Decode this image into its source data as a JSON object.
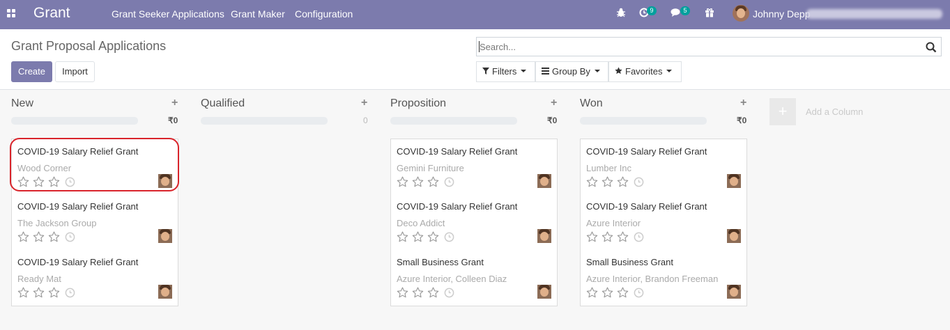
{
  "topbar": {
    "apps_icon": "apps-grid-icon",
    "brand": "Grant",
    "menu": [
      "Grant Seeker Applications",
      "Grant Maker",
      "Configuration"
    ],
    "icons": {
      "bug": "bug-icon",
      "activity": "activity-clock-icon",
      "activity_count": "9",
      "messages": "chat-icon",
      "messages_count": "5",
      "gift": "gift-icon"
    },
    "user_name": "Johnny Depp"
  },
  "control": {
    "title": "Grant Proposal Applications",
    "create_label": "Create",
    "import_label": "Import",
    "search_placeholder": "Search...",
    "filters_label": "Filters",
    "group_by_label": "Group By",
    "favorites_label": "Favorites"
  },
  "columns": [
    {
      "title": "New",
      "total": "₹0"
    },
    {
      "title": "Qualified",
      "total": "0"
    },
    {
      "title": "Proposition",
      "total": "₹0"
    },
    {
      "title": "Won",
      "total": "₹0"
    }
  ],
  "add_column_label": "Add a Column",
  "cards": {
    "new": [
      {
        "title": "COVID-19 Salary Relief Grant",
        "partner": "Wood Corner"
      },
      {
        "title": "COVID-19 Salary Relief Grant",
        "partner": "The Jackson Group"
      },
      {
        "title": "COVID-19 Salary Relief Grant",
        "partner": "Ready Mat"
      }
    ],
    "proposition": [
      {
        "title": "COVID-19 Salary Relief Grant",
        "partner": "Gemini Furniture"
      },
      {
        "title": "COVID-19 Salary Relief Grant",
        "partner": "Deco Addict"
      },
      {
        "title": "Small Business Grant",
        "partner": "Azure Interior, Colleen Diaz"
      }
    ],
    "won": [
      {
        "title": "COVID-19 Salary Relief Grant",
        "partner": "Lumber Inc"
      },
      {
        "title": "COVID-19 Salary Relief Grant",
        "partner": "Azure Interior"
      },
      {
        "title": "Small Business Grant",
        "partner": "Azure Interior, Brandon Freeman"
      }
    ]
  },
  "colors": {
    "brand": "#7c7bad",
    "badge": "#00a09d",
    "highlight": "#d9242b"
  }
}
